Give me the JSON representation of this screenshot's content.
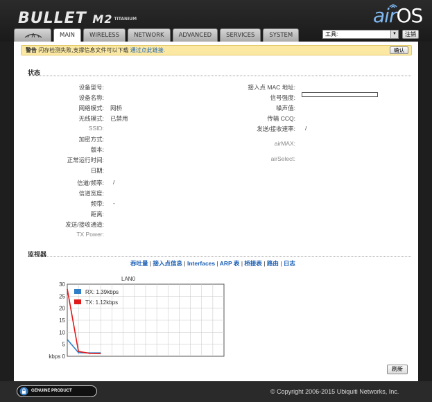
{
  "header": {
    "product": "BULLET",
    "model": "M2",
    "edition": "TITANIUM",
    "brand_air": "air",
    "brand_os": "OS"
  },
  "tabs": [
    {
      "label": "MAIN",
      "active": true
    },
    {
      "label": "WIRELESS",
      "active": false
    },
    {
      "label": "NETWORK",
      "active": false
    },
    {
      "label": "ADVANCED",
      "active": false
    },
    {
      "label": "SERVICES",
      "active": false
    },
    {
      "label": "SYSTEM",
      "active": false
    }
  ],
  "tools": {
    "selected": "工具:",
    "logout": "注销"
  },
  "warning": {
    "prefix": "警告",
    "message": "闪存检测失败,支撑信息文件可以下载",
    "link": "通过点此链接.",
    "confirm": "确认"
  },
  "status": {
    "title": "状态",
    "left": [
      {
        "label": "设备型号:",
        "value": ""
      },
      {
        "label": "设备名称:",
        "value": ""
      },
      {
        "label": "网络模式:",
        "value": "网桥"
      },
      {
        "label": "无线模式:",
        "value": "已禁用"
      },
      {
        "label": "SSID:",
        "value": ""
      },
      {
        "label": "加密方式:",
        "value": ""
      },
      {
        "label": "版本:",
        "value": ""
      },
      {
        "label": "正常运行时间:",
        "value": ""
      },
      {
        "label": "日期:",
        "value": ""
      },
      {
        "label": "信道/频率:",
        "value": "/"
      },
      {
        "label": "信道宽度:",
        "value": ""
      },
      {
        "label": "频带:",
        "value": "-"
      },
      {
        "label": "距离:",
        "value": ""
      },
      {
        "label": "发送/接收通道:",
        "value": ""
      },
      {
        "label": "TX Power:",
        "value": ""
      }
    ],
    "right": [
      {
        "label": "接入点 MAC 地址:",
        "value": ""
      },
      {
        "label": "信号强度:",
        "value": ""
      },
      {
        "label": "噪声值:",
        "value": ""
      },
      {
        "label": "传输 CCQ:",
        "value": ""
      },
      {
        "label": "发送/接收速率:",
        "value": "/"
      },
      {
        "label": "airMAX:",
        "value": ""
      },
      {
        "label": "airSelect:",
        "value": ""
      }
    ]
  },
  "monitor": {
    "title": "监视器",
    "links": [
      "吞吐量",
      "接入点信息",
      "Interfaces",
      "ARP 表",
      "桥接表",
      "路由",
      "日志"
    ],
    "refresh": "刷新"
  },
  "chart_data": {
    "type": "line",
    "title": "LAN0",
    "ylabel": "kbps",
    "yticks": [
      0,
      5,
      10,
      15,
      20,
      25,
      30
    ],
    "ylim": [
      0,
      30
    ],
    "x": [
      0,
      1,
      2,
      3
    ],
    "series": [
      {
        "name": "RX: 1.39kbps",
        "color": "#2e7fc8",
        "values": [
          7,
          1.5,
          1.4,
          1.39
        ]
      },
      {
        "name": "TX: 1.12kbps",
        "color": "#e01818",
        "values": [
          28,
          2,
          1.2,
          1.12
        ]
      }
    ],
    "grid": true,
    "legend": "top-left"
  },
  "footer": {
    "badge": "GENUINE  PRODUCT",
    "copyright": "© Copyright 2006-2015 Ubiquiti Networks, Inc."
  }
}
